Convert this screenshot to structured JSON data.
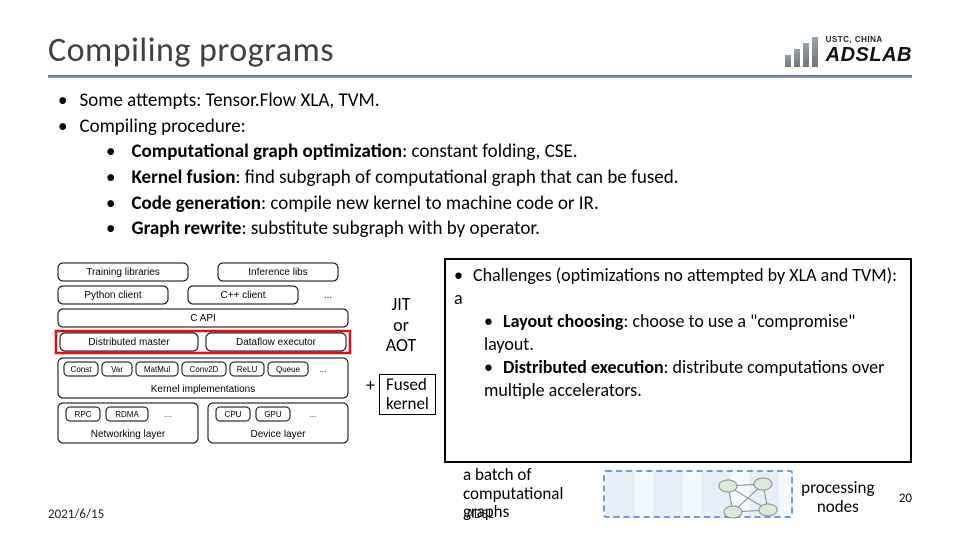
{
  "header": {
    "title": "Compiling programs",
    "org_line1": "USTC, CHINA",
    "org_line2": "ADSLAB"
  },
  "bullets": {
    "a": "Some attempts: Tensor.Flow XLA, TVM.",
    "b": "Compiling procedure:",
    "sub": {
      "cgo_b": "Computational graph optimization",
      "cgo_r": ": constant folding, CSE.",
      "kf_b": "Kernel fusion",
      "kf_r": ": find subgraph of computational graph that can be fused.",
      "cg_b": "Code generation",
      "cg_r": ": compile new kernel to machine code or IR.",
      "gr_b": "Graph rewrite",
      "gr_r": ": substitute subgraph with by operator."
    }
  },
  "diagram": {
    "train": "Training libraries",
    "infer": "Inference libs",
    "py": "Python client",
    "cpp": "C++ client",
    "dots1": "...",
    "capi": "C API",
    "dist": "Distributed master",
    "dflow": "Dataflow executor",
    "k_const": "Const",
    "k_var": "Var",
    "k_matmul": "MatMul",
    "k_conv": "Conv2D",
    "k_relu": "ReLU",
    "k_queue": "Queue",
    "k_dots": "...",
    "kimpl": "Kernel implementations",
    "rpc": "RPC",
    "rdma": "RDMA",
    "net_dots": "...",
    "net": "Networking layer",
    "cpu": "CPU",
    "gpu": "GPU",
    "dev_dots": "...",
    "dev": "Device layer"
  },
  "mid": {
    "jit1": "JIT",
    "jit2": "or",
    "jit3": "AOT",
    "plus": "+",
    "fused1": "Fused",
    "fused2": "kernel"
  },
  "challenges": {
    "head": "Challenges (optimizations no attempted by XLA and TVM): a",
    "lc_b": "Layout choosing",
    "lc_r": ": choose to use a \"compromise\" layout.",
    "de_b": "Distributed execution",
    "de_r": ": distribute computations over multiple accelerators."
  },
  "footer": {
    "date": "2021/6/15",
    "batch1": "a batch of",
    "batch2": "computational",
    "batch3": "graphs",
    "adsl": "ADSL",
    "nodes1": "processing",
    "nodes2": "nodes",
    "page": "20"
  }
}
